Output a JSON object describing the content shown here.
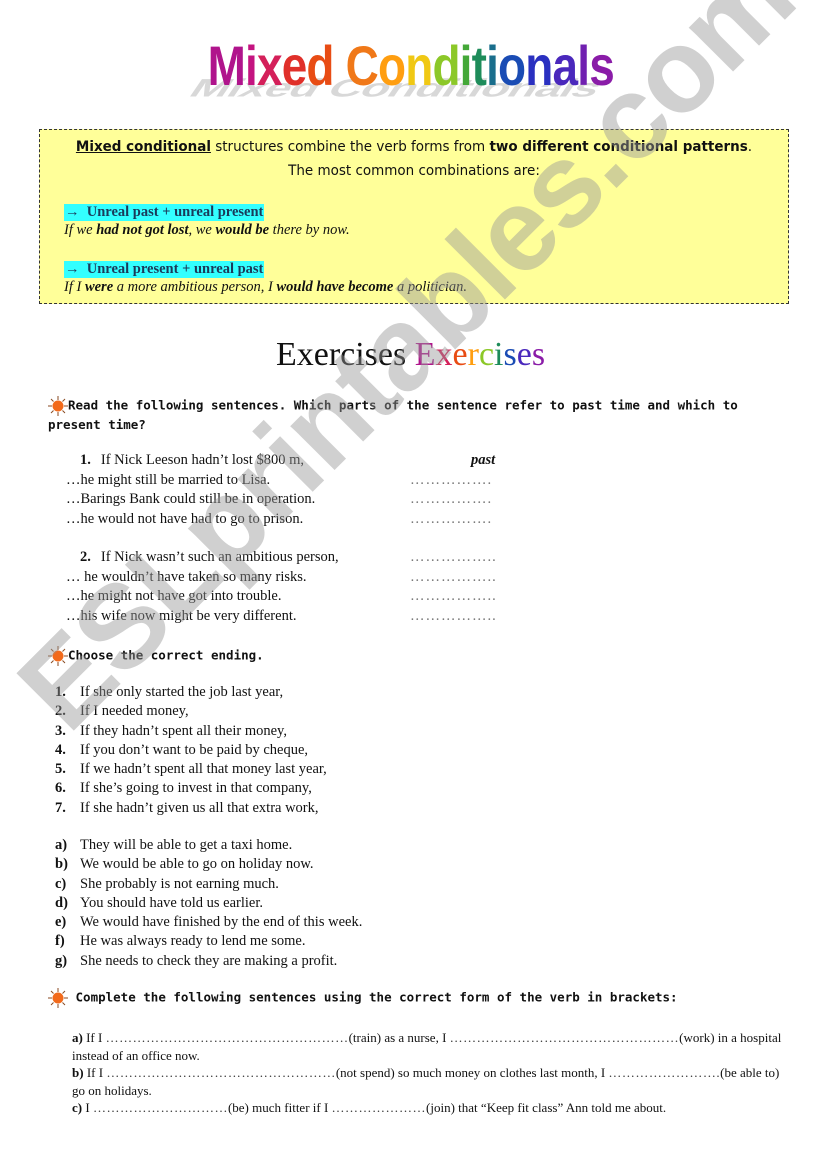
{
  "title": "Mixed Conditionals",
  "title_letter_colors": [
    "#b0148c",
    "#c41480",
    "#d4205a",
    "#e0302a",
    "#e84c14",
    "#f07818",
    "#ff9e10",
    "#f0c814",
    "#c8d81e",
    "#8cc828",
    "#44a838",
    "#1e8c5a",
    "#1a6e8c",
    "#1a4cb4",
    "#2a30c0",
    "#4a28bc",
    "#7020b0",
    "#8a1ca8"
  ],
  "intro": {
    "line1_underlined": "Mixed conditional",
    "line1_mid": " structures combine the verb forms from ",
    "line1_bold": "two different conditional patterns",
    "line1_end": ".",
    "line2": "The most common combinations are:",
    "combos": [
      {
        "arrow": "→",
        "heading": "Unreal past + unreal present",
        "example_parts": [
          {
            "text": "If we ",
            "bold": false
          },
          {
            "text": "had not got lost",
            "bold": true
          },
          {
            "text": ", we ",
            "bold": false
          },
          {
            "text": "would be",
            "bold": true
          },
          {
            "text": " there by now.",
            "bold": false
          }
        ]
      },
      {
        "arrow": "→",
        "heading": "Unreal present + unreal past",
        "example_parts": [
          {
            "text": "If I ",
            "bold": false
          },
          {
            "text": "were",
            "bold": true
          },
          {
            "text": " a more ambitious person, I ",
            "bold": false
          },
          {
            "text": "would have become",
            "bold": true
          },
          {
            "text": " a politician.",
            "bold": false
          }
        ]
      }
    ]
  },
  "exercises_title": "Exercises",
  "exercise1": {
    "instruction": "Read the following sentences. Which parts of the sentence refer to past time and which to present time?",
    "groups": [
      {
        "number": "1.",
        "head": "If Nick Leeson hadn’t lost $800 m,",
        "head_answer": "past",
        "lines": [
          {
            "text": "…he might still be married to Lisa.",
            "answer": "……………."
          },
          {
            "text": "…Barings Bank could still be in operation.",
            "answer": "……………."
          },
          {
            "text": "…he would not have had to go to prison.",
            "answer": "……………."
          }
        ]
      },
      {
        "number": "2.",
        "head": "If Nick wasn’t such an ambitious person,",
        "head_answer": "……………..",
        "lines": [
          {
            "text": "… he wouldn’t have taken so many risks.",
            "answer": "…………….."
          },
          {
            "text": "…he might not have got into trouble.",
            "answer": "…………….."
          },
          {
            "text": "…his wife now might be very different.",
            "answer": "…………….."
          }
        ]
      }
    ]
  },
  "exercise2": {
    "instruction": "Choose the correct ending.",
    "beginnings": [
      {
        "num": "1.",
        "text": "If she only started the job last year,"
      },
      {
        "num": "2.",
        "text": "If I needed money,"
      },
      {
        "num": "3.",
        "text": "If they hadn’t spent all their money,"
      },
      {
        "num": "4.",
        "text": "If you don’t want to be paid by cheque,"
      },
      {
        "num": "5.",
        "text": "If we hadn’t spent all that money last year,"
      },
      {
        "num": "6.",
        "text": "If she’s going to invest in that company,"
      },
      {
        "num": "7.",
        "text": "If she hadn’t given us all that extra work,"
      }
    ],
    "endings": [
      {
        "num": "a)",
        "text": "They will be able to get a taxi home."
      },
      {
        "num": "b)",
        "text": "We would be able to go on holiday now."
      },
      {
        "num": "c)",
        "text": "She probably is not earning much."
      },
      {
        "num": "d)",
        "text": "You should have told us earlier."
      },
      {
        "num": "e)",
        "text": "We would have finished by the end of this week."
      },
      {
        "num": "f)",
        "text": "He was always ready to lend me some."
      },
      {
        "num": "g)",
        "text": "She needs to check they are making a profit."
      }
    ]
  },
  "exercise3": {
    "instruction": "Complete the following sentences using the correct form of the verb in brackets:",
    "items": [
      {
        "label": "a)",
        "parts": [
          {
            "t": " If I ",
            "dots": false
          },
          {
            "t": "………………………………………………",
            "dots": true
          },
          {
            "t": "(train) as a nurse, I ",
            "dots": false
          },
          {
            "t": "……………………………………………",
            "dots": true
          },
          {
            "t": "(work) in a hospital instead of an office now.",
            "dots": false
          }
        ]
      },
      {
        "label": "b)",
        "parts": [
          {
            "t": " If I ",
            "dots": false
          },
          {
            "t": "……………………………………………",
            "dots": true
          },
          {
            "t": "(not spend) so much money on clothes last month, I ",
            "dots": false
          },
          {
            "t": "…………………….",
            "dots": true
          },
          {
            "t": "(be able to) go on holidays.",
            "dots": false
          }
        ]
      },
      {
        "label": "c)",
        "parts": [
          {
            "t": " I ",
            "dots": false
          },
          {
            "t": "…………………………",
            "dots": true
          },
          {
            "t": "(be) much fitter if I ",
            "dots": false
          },
          {
            "t": "…………………",
            "dots": true
          },
          {
            "t": "(join) that “Keep fit class” Ann told me about.",
            "dots": false
          }
        ]
      }
    ]
  },
  "watermark": "ESLprintables.com",
  "colors": {
    "intro_bg": "#ffff99",
    "highlight": "#33ffff",
    "sun": "#f26a1b"
  }
}
